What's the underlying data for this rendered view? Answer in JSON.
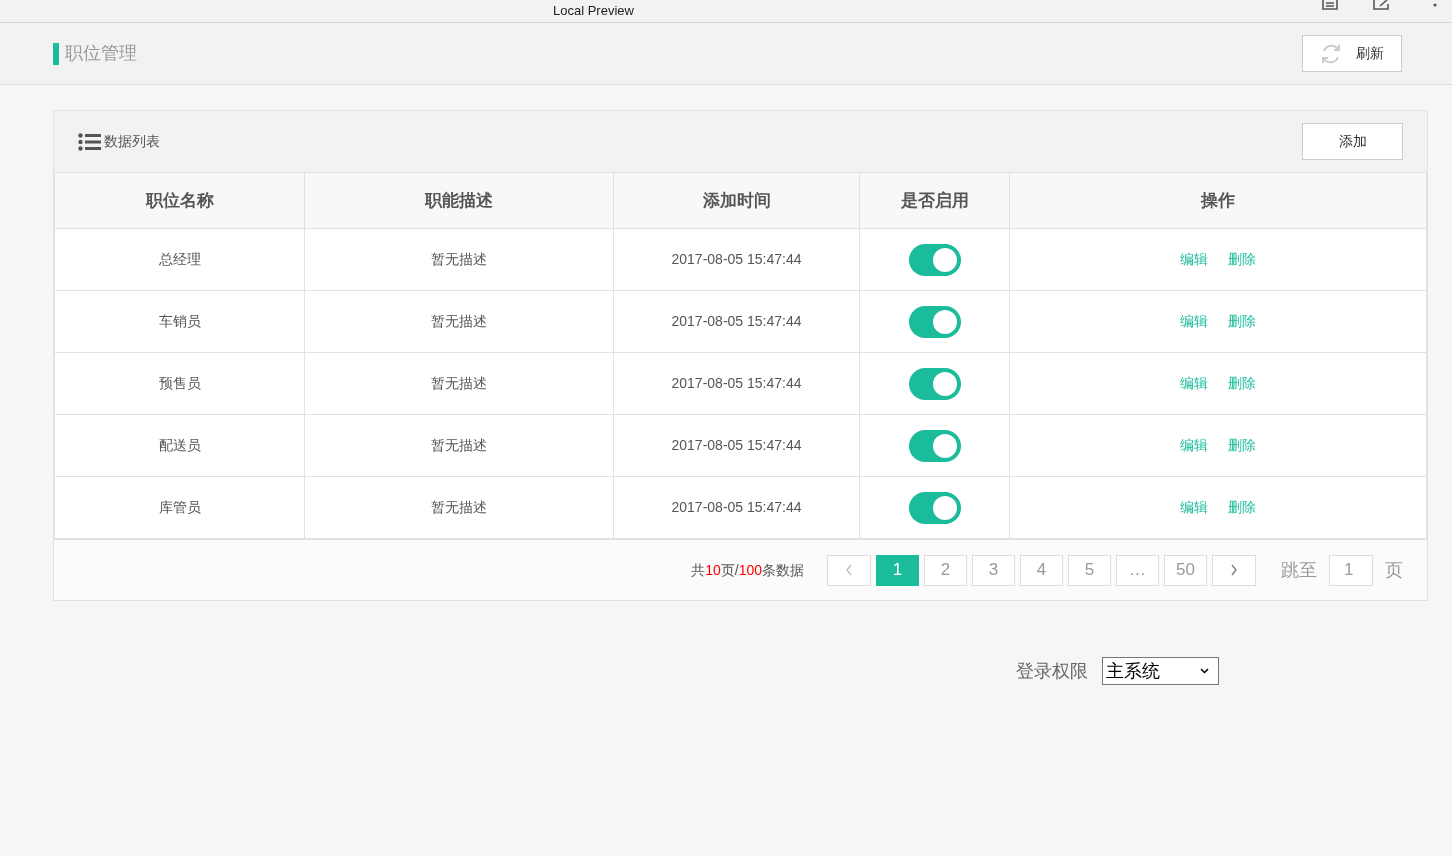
{
  "window": {
    "title": "Local Preview"
  },
  "header": {
    "title": "职位管理",
    "refresh_button": "刷新"
  },
  "panel": {
    "title": "数据列表",
    "add_button": "添加"
  },
  "table": {
    "columns": [
      "职位名称",
      "职能描述",
      "添加时间",
      "是否启用",
      "操作"
    ],
    "rows": [
      {
        "name": "总经理",
        "description": "暂无描述",
        "time": "2017-08-05 15:47:44",
        "enabled": true,
        "actions": [
          "编辑",
          "删除"
        ]
      },
      {
        "name": "车销员",
        "description": "暂无描述",
        "time": "2017-08-05 15:47:44",
        "enabled": true,
        "actions": [
          "编辑",
          "删除"
        ]
      },
      {
        "name": "预售员",
        "description": "暂无描述",
        "time": "2017-08-05 15:47:44",
        "enabled": true,
        "actions": [
          "编辑",
          "删除"
        ]
      },
      {
        "name": "配送员",
        "description": "暂无描述",
        "time": "2017-08-05 15:47:44",
        "enabled": true,
        "actions": [
          "编辑",
          "删除"
        ]
      },
      {
        "name": "库管员",
        "description": "暂无描述",
        "time": "2017-08-05 15:47:44",
        "enabled": true,
        "actions": [
          "编辑",
          "删除"
        ]
      }
    ]
  },
  "pagination": {
    "summary": [
      "共",
      "10",
      "页/",
      "100",
      "条数据"
    ],
    "pages": [
      {
        "label": "1",
        "selected": true
      },
      {
        "label": "2",
        "selected": false
      },
      {
        "label": "3",
        "selected": false
      },
      {
        "label": "4",
        "selected": false
      },
      {
        "label": "5",
        "selected": false
      },
      {
        "label": "…",
        "selected": false
      },
      {
        "label": "50",
        "selected": false
      }
    ],
    "jump_label": "跳至",
    "jump_value": "1",
    "page_unit": "页"
  },
  "login_permission": {
    "label": "登录权限",
    "value": "主系统"
  }
}
